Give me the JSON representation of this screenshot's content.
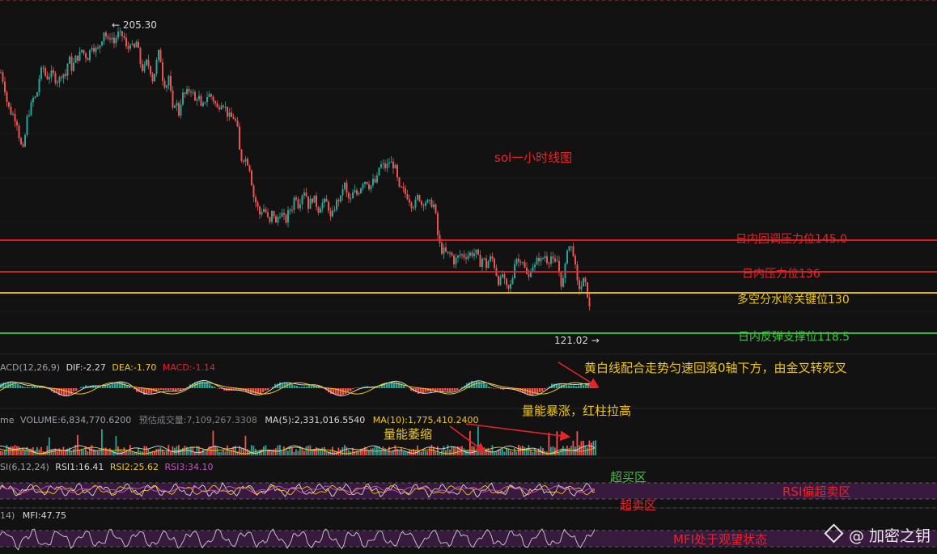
{
  "chart_title": "sol一小时线图",
  "price_labels": {
    "high": "← 205.30",
    "low": "121.02 →"
  },
  "levels": [
    {
      "label": "日内回调压力位145.0",
      "value": 145.0,
      "color": "#e8242b"
    },
    {
      "label": "日内压力位136",
      "value": 136,
      "color": "#e8242b"
    },
    {
      "label": "多空分水岭关键位130",
      "value": 130,
      "color": "#f2c811"
    },
    {
      "label": "日内反弹支撑位118.5",
      "value": 118.5,
      "color": "#3ec93a"
    }
  ],
  "macd": {
    "name": "ACD(12,26,9)",
    "dif": "DIF:-2.27",
    "dea": "DEA:-1.70",
    "macd": "MACD:-1.14"
  },
  "volume": {
    "name": "me",
    "volume": "VOLUME:6,834,770.6200",
    "est": "预估成交量:7,109,267.3308",
    "ma5": "MA(5):2,331,016.5540",
    "ma10": "MA(10):1,775,410.2400"
  },
  "rsi": {
    "name": "SI(6,12,24)",
    "rsi1": "RSI1:16.41",
    "rsi2": "RSI2:25.62",
    "rsi3": "RSI3:34.10"
  },
  "mfi": {
    "name": "14)",
    "mfi": "MFI:47.75"
  },
  "annotations": {
    "macd_note": "黄白线配合走势匀速回落0轴下方，由金叉转死叉",
    "vol_surge": "量能暴涨，红柱拉高",
    "vol_shrink": "量能萎缩",
    "overbought": "超买区",
    "rsi_note": "RSI偏超卖区",
    "oversold": "超卖区",
    "mfi_note": "MFI处于观望状态"
  },
  "watermark": "@ 加密之钥",
  "colors": {
    "up": "#26a69a",
    "down": "#ef5350",
    "bg": "#121212"
  },
  "chart_data": {
    "type": "line",
    "title": "sol一小时线图",
    "x": [
      0,
      4,
      8,
      12,
      16,
      20,
      24,
      28,
      32,
      36,
      40,
      44,
      48,
      52,
      56,
      60,
      64,
      68,
      72,
      76,
      80,
      84,
      88,
      92,
      96,
      100,
      104,
      108,
      112,
      116,
      120,
      124,
      128,
      132,
      136,
      140,
      144,
      148,
      152,
      156,
      160,
      164,
      168,
      172,
      176,
      180,
      184,
      188,
      192,
      196,
      200,
      204,
      208,
      212,
      216,
      220,
      224,
      228,
      232,
      236,
      240,
      244,
      248,
      252,
      256,
      260,
      264,
      268,
      272,
      276,
      280,
      284,
      288,
      292,
      296,
      300,
      304,
      308,
      312,
      316,
      320,
      324,
      328,
      332,
      336,
      340,
      344,
      348,
      352,
      356,
      360,
      364,
      368,
      372,
      376,
      380,
      384,
      388,
      392,
      396,
      400,
      404,
      408,
      412,
      416,
      420,
      424,
      428,
      432,
      436,
      440,
      444,
      448,
      452,
      456,
      460,
      464,
      468,
      472,
      476,
      480,
      484,
      488,
      492,
      496,
      500,
      504,
      508,
      512,
      516,
      520,
      524,
      528,
      532,
      536,
      540,
      544,
      548,
      552,
      556,
      560,
      564,
      568,
      572,
      576,
      580,
      584,
      588,
      592,
      596,
      600,
      604,
      608,
      612,
      616,
      620,
      624,
      628,
      632,
      636,
      640,
      644,
      648,
      652,
      656,
      660,
      664,
      668,
      672,
      676,
      680,
      684,
      688,
      692,
      696,
      700,
      704,
      708,
      712,
      716,
      720,
      724,
      728,
      732,
      736
    ],
    "close": [
      192.8,
      189.5,
      183.8,
      181.5,
      180.6,
      178.5,
      172.5,
      170.3,
      179.4,
      182.3,
      185.3,
      185.7,
      191.9,
      194.5,
      191.1,
      191.9,
      192.6,
      190.5,
      190.7,
      192.8,
      191.9,
      197.4,
      193.5,
      196.8,
      197.1,
      199.2,
      197.6,
      197.0,
      200.8,
      199.4,
      199.2,
      201.7,
      205.0,
      201.3,
      203.6,
      201.2,
      203.9,
      203.4,
      203.1,
      198.5,
      201.6,
      198.8,
      201.8,
      195.8,
      193.1,
      195.7,
      194.2,
      190.3,
      195.3,
      199.3,
      191.2,
      188.4,
      192.3,
      181.3,
      185.2,
      181.0,
      186.4,
      186.5,
      187.6,
      188.0,
      184.5,
      186.8,
      181.8,
      184.7,
      186.6,
      186.0,
      184.4,
      182.2,
      184.5,
      183.7,
      180.9,
      179.9,
      180.0,
      177.6,
      168.0,
      168.4,
      167.9,
      165.2,
      157.7,
      155.2,
      152.4,
      154.3,
      152.8,
      149.1,
      154.0,
      149.5,
      152.9,
      152.2,
      150.2,
      153.5,
      154.3,
      158.5,
      154.5,
      158.1,
      159.5,
      154.7,
      156.8,
      156.6,
      153.4,
      155.4,
      155.8,
      155.4,
      150.6,
      154.1,
      156.4,
      156.8,
      161.9,
      157.5,
      156.0,
      158.9,
      158.1,
      159.8,
      162.0,
      161.9,
      159.9,
      161.7,
      161.3,
      166.3,
      166.3,
      165.6,
      167.3,
      166.7,
      165.2,
      159.3,
      159.6,
      158.2,
      157.1,
      154.9,
      155.4,
      157.9,
      155.3,
      156.2,
      155.6,
      155.4,
      154.9,
      146.5,
      142.0,
      142.0,
      140.7,
      141.4,
      138.9,
      139.9,
      141.1,
      140.5,
      140.6,
      141.2,
      141.2,
      141.4,
      138.2,
      140.3,
      137.5,
      139.9,
      139.6,
      135.8,
      132.4,
      135.3,
      131.6,
      130.7,
      133.6,
      140.8,
      138.8,
      140.2,
      136.4,
      133.7,
      138.0,
      137.5,
      140.1,
      139.0,
      140.9,
      138.7,
      140.4,
      137.9,
      139.2,
      132.5,
      133.9,
      143.0,
      143.4,
      141.2,
      132.9,
      131.1,
      133.5,
      131.2,
      124.7
    ],
    "ylim": [
      117.8,
      207.2
    ]
  }
}
